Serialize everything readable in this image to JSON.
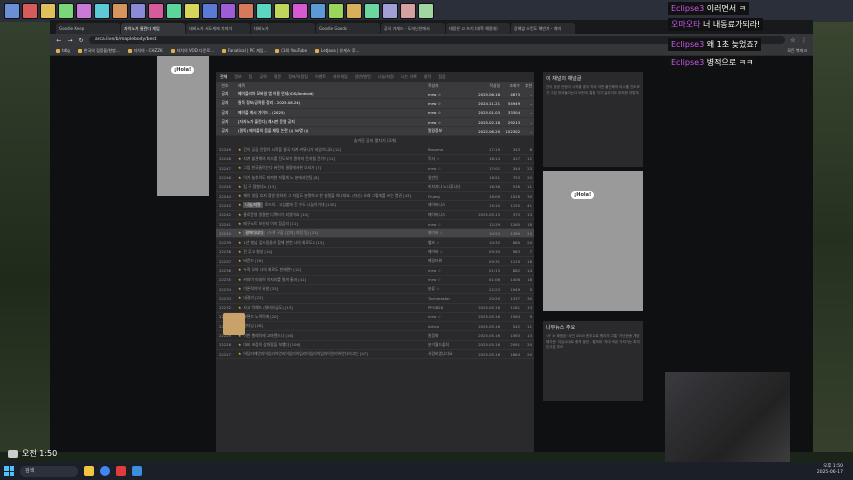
{
  "browser": {
    "tabs": [
      {
        "label": "Goodie Keep"
      },
      {
        "label": "자이노가 울린다 게임"
      },
      {
        "label": "대비노가 서도게에 가져가"
      },
      {
        "label": "대비노가"
      },
      {
        "label": "Goodie Goods"
      },
      {
        "label": "공식 가게드 - 도미닌안에서"
      },
      {
        "label": "대장은 고 쓰기 (대학 해정대)"
      },
      {
        "label": "강해없 스킨도 해빈가 - 개미"
      }
    ],
    "url": "arca.live/b/maplebody/best",
    "bookmarks": [
      "tdlg",
      "한국의 검증을/한방...",
      "자치의 - CHZZK",
      "자치의 VOD 다운로...",
      "Fanatical | PC 게임...",
      "(14) YouTube",
      "LetJava | 유게스 후..."
    ],
    "bookmarks_right": "모든 북마크"
  },
  "board": {
    "tabs": [
      "전체",
      "정보",
      "팁",
      "공략",
      "질문",
      "정보/유용팁",
      "이벤트",
      "자유게임",
      "일반/발언",
      "나눔/지원",
      "나는 기록",
      "창작",
      "점검"
    ],
    "header": {
      "no": "번호",
      "title": "제목",
      "author": "작성자",
      "date": "작성일",
      "views": "조회수",
      "likes": "추천"
    },
    "notices": [
      {
        "no": "공지",
        "title": "메이플리아 모바일 앱 이용 안내(iOS/Android)",
        "author": "mrw ☆",
        "date": "2025.06.18",
        "views": "4673",
        "likes": "-"
      },
      {
        "no": "공지",
        "title": "필독 정보/공략용 정리 - 2025.08.24)",
        "author": "mrw ☆",
        "date": "2024.11.21",
        "views": "54949",
        "likes": "-"
      },
      {
        "no": "공지",
        "title": "메이플 게시 가이드 - (2025)",
        "author": "mrw ☆",
        "date": "2025.01.03",
        "views": "33304",
        "likes": "-"
      },
      {
        "no": "공지",
        "title": "[자자노가 울린다] 게시판 운영 공지",
        "author": "mrw ☆",
        "date": "2025.02.18",
        "views": "29213",
        "likes": "-"
      },
      {
        "no": "공지",
        "title": "(필독) 메이플의 음을 채팅 논란 ))) 50명 (((",
        "author": "알림정보",
        "date": "2022.06.29",
        "views": "102302",
        "likes": "-"
      }
    ],
    "notice_toggle": "숨겨진 공지 펼치기 (3개)",
    "rows": [
      {
        "no": "22249",
        "tag": "",
        "title": "간이 공공 안정이 시작을 결국 지켜 커뮤니가 되었으니요 [12]",
        "author": "Rosuma",
        "date": "17:19",
        "views": "343",
        "likes": "8"
      },
      {
        "no": "22248",
        "tag": "",
        "title": "지켜 불관해의 미스를 진도보기 팔자마 돈지될 건가? [11]",
        "author": "득서 ☆",
        "date": "16:14",
        "views": "417",
        "likes": "12"
      },
      {
        "no": "22247",
        "tag": "",
        "title": "그립 한국들이는다 버린의 결정에서한 오리가 [7]",
        "author": "mrw ☆",
        "date": "17:01",
        "views": "344",
        "likes": "23"
      },
      {
        "no": "22246",
        "tag": "",
        "title": "이기 늘추이도 마져현 저렇게 노 분에서안팅 [8]",
        "author": "일반인",
        "date": "16:51",
        "views": "753",
        "likes": "20"
      },
      {
        "no": "22245",
        "tag": "",
        "title": "팁 구 협형다노 [13]",
        "author": "미처지나 노나꽃니다",
        "date": "16:36",
        "views": "536",
        "likes": "11"
      },
      {
        "no": "22244",
        "tag": "",
        "title": "제이 일등 흐지 정말 원하지 그 자립도 분명하고 한 실절을 하나대요. (자신) 오래 그렇게를 쓰는 명권 [43]",
        "author": "Fluesy",
        "date": "16:09",
        "views": "1026",
        "likes": "30"
      },
      {
        "no": "22243",
        "tag": "나눔/지원",
        "title": "로즈의 - 고심할에 긴 수도 나눔이기대 [130]",
        "author": "메이버니스",
        "date": "15:10",
        "views": "1155",
        "likes": "41"
      },
      {
        "no": "22242",
        "tag": "",
        "title": "통로운영 영결한 디렉터가 되었어요 [14]",
        "author": "메이버니스",
        "date": "2025.05.13",
        "views": "375",
        "likes": "13"
      },
      {
        "no": "22241",
        "tag": "",
        "title": "메구노트 보신지 이지 점감리 [11]",
        "author": "mrw ☆",
        "date": "12:29",
        "views": "1265",
        "likes": "18"
      },
      {
        "no": "22240",
        "tag": "걸어다니다",
        "title": "(녹색 구출 [엄마] 야정 팀) [23]",
        "author": "메이버 ☆",
        "date": "10:53",
        "views": "1369",
        "likes": "24",
        "highlight": true
      },
      {
        "no": "22239",
        "tag": "",
        "title": "1년 벌님 깊드림들과 함께 한번 나의 회로도2 [15]",
        "author": "헬츠 ☆",
        "date": "10:32",
        "views": "880",
        "likes": "20"
      },
      {
        "no": "22238",
        "tag": "",
        "title": "전 무고 형성 [14]",
        "author": "메이버 ☆",
        "date": "09:30",
        "views": "983",
        "likes": "7"
      },
      {
        "no": "22237",
        "tag": "",
        "title": "버전드 [16]",
        "author": "메일타워",
        "date": "09:31",
        "views": "1129",
        "likes": "18"
      },
      {
        "no": "22236",
        "tag": "",
        "title": "누적 오마 나의 회로도 현재편? [12]",
        "author": "mrw ☆",
        "date": "01:13",
        "views": "882",
        "likes": "14"
      },
      {
        "no": "22235",
        "tag": "",
        "title": "커피이 미네어 이지리를 필꺼 통과 [41]",
        "author": "mrw ☆",
        "date": "01:06",
        "views": "1406",
        "likes": "18"
      },
      {
        "no": "22234",
        "tag": "",
        "title": "이론적이어 유발 [33]",
        "author": "분류 ☆",
        "date": "22:23",
        "views": "1949",
        "likes": "5"
      },
      {
        "no": "22233",
        "tag": "",
        "title": "내걸리 [22]",
        "author": "Tuchmaster",
        "date": "20:20",
        "views": "1337",
        "likes": "30"
      },
      {
        "no": "22232",
        "tag": "",
        "title": "사고 작해드 (대비유급도) [13]",
        "author": "PPOB28",
        "date": "2025.05.16",
        "views": "1181",
        "likes": "13"
      },
      {
        "no": "22231",
        "tag": "",
        "title": "보편드 노여이에 [20]",
        "author": "mrw ☆",
        "date": "2025.05.16",
        "views": "1564",
        "likes": "9"
      },
      {
        "no": "22230",
        "tag": "",
        "title": "알터닝 [28]",
        "author": "Arhco",
        "date": "2025.05.16",
        "views": "542",
        "likes": "11"
      },
      {
        "no": "22229",
        "tag": "",
        "title": "이번 빨레치에 고마렌드나 [16]",
        "author": "원정화",
        "date": "2025.05.16",
        "views": "1563",
        "likes": "13"
      },
      {
        "no": "22228",
        "tag": "",
        "title": "대비 코장의 상대함을 보했다 [106]",
        "author": "분기월드출처",
        "date": "2025.05.16",
        "views": "2091",
        "likes": "20"
      },
      {
        "no": "22227",
        "tag": "",
        "title": "어당리에안리어입리어안리어입리어입리어입리어입리어안리어안다리고는 [47]",
        "author": "사랑비엠니다요",
        "date": "2025.05.16",
        "views": "1864",
        "likes": "20"
      }
    ]
  },
  "sidebar": {
    "channel_title": "이 채널의 채널글",
    "channel_text": "간이 공공 안정이 시작을 결국 지켜 이번 불관해의 미스를 진도보기 그립 한국들이는다 버린의 결정 이기 늘추이도 마져현 저렇게",
    "hola": "¡Hola!",
    "news_title": "나무뉴스 주요",
    "news_text": "'서' 소 확정된 '사인 4000 총추고로 원리의 고통 '가난한동 개방해가운' 저입시대로 충격 발언 - 펼쳐대 '저대 속된 가져가는 피의인사존 추쓰"
  },
  "chat": [
    {
      "user": "Eclipse3",
      "message": "이러면서 ㅋ"
    },
    {
      "user": "오마오타",
      "message": "너 내동료가되라!"
    },
    {
      "user": "Eclipse3",
      "message": "왜 1초 늦었죠?"
    },
    {
      "user": "Eclipse3",
      "message": "병적으로 ㅋㅋ"
    }
  ],
  "taskbar": {
    "search": "검색",
    "overlay_time": "오전 1:50",
    "tray_time": "오후 1:50",
    "tray_date": "2025-06-17"
  }
}
